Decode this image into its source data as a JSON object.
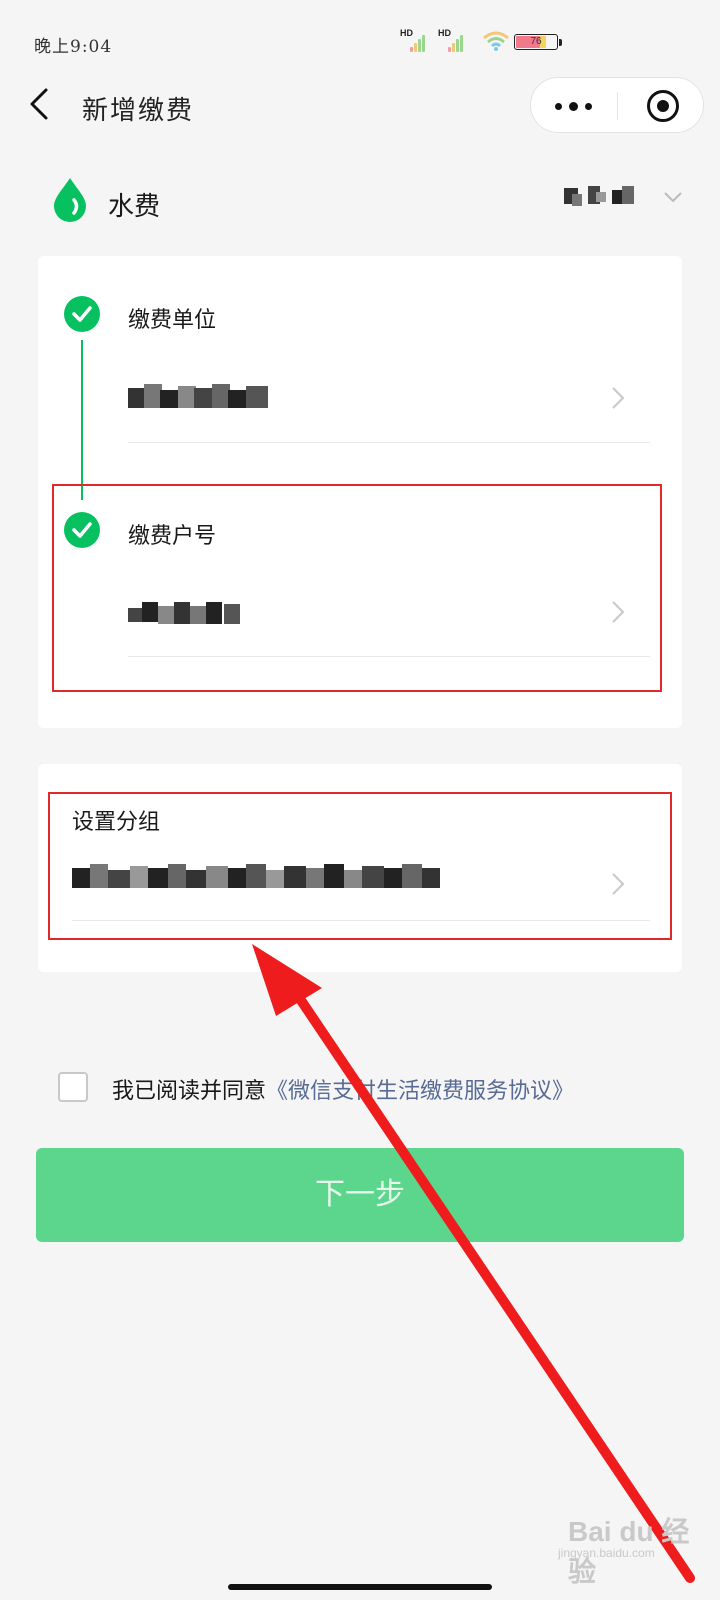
{
  "status_bar": {
    "time": "晚上9:04",
    "signal_1": "HD",
    "signal_2": "HD",
    "battery": "76"
  },
  "nav": {
    "title": "新增缴费",
    "back_icon": "chevron-left-icon",
    "more_icon": "more-dots-icon",
    "close_icon": "mini-program-close-icon"
  },
  "bill_type": {
    "label": "水费",
    "icon": "water-drop-icon",
    "icon_color": "#07c160"
  },
  "steps": [
    {
      "label": "缴费单位",
      "status": "done"
    },
    {
      "label": "缴费户号",
      "status": "done"
    }
  ],
  "group": {
    "label": "设置分组"
  },
  "agreement": {
    "prefix": "我已阅读并同意",
    "link": "《微信支付生活缴费服务协议》",
    "checked": false
  },
  "next_button": {
    "label": "下一步",
    "color": "#5cd68d"
  },
  "watermark": {
    "main": "Bai du 经验",
    "sub": "jingyan.baidu.com"
  },
  "colors": {
    "accent": "#07c160",
    "link": "#576b95",
    "annotation": "#e02a2a"
  }
}
